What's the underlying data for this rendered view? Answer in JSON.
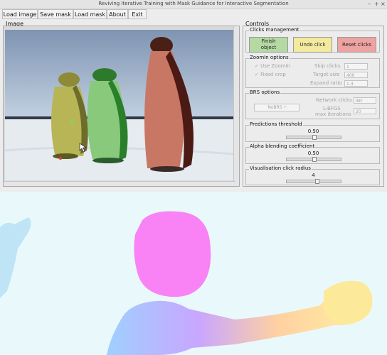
{
  "window": {
    "title": "Reviving Iterative Training with Mask Guidance for Interactive Segmentation",
    "controls": [
      "–",
      "+",
      "×"
    ]
  },
  "menu": [
    "Load image",
    "Save mask",
    "Load mask",
    "About",
    "Exit"
  ],
  "image_panel": {
    "label": "Image"
  },
  "controls": {
    "label": "Controls",
    "clicks": {
      "title": "Clicks management",
      "finish_label": "Finish\nobject",
      "undo_label": "Undo click",
      "reset_label": "Reset clicks",
      "colors": {
        "finish": "#b5d9a3",
        "undo": "#f3eaa0",
        "reset": "#eea3a3"
      }
    },
    "zoomin": {
      "title": "ZoomIn options",
      "use_zoomin": "Use ZoomIn",
      "fixed_crop": "Fixed crop",
      "skip_clicks_label": "Skip clicks",
      "skip_clicks": "1",
      "target_size_label": "Target size",
      "target_size": "400",
      "expand_ratio_label": "Expand ratio",
      "expand_ratio": "1.4"
    },
    "brs": {
      "title": "BRS options",
      "mode": "NoBRS",
      "network_clicks_label": "Network clicks",
      "network_clicks": "INF",
      "lbfgs_label_1": "L-BFGS",
      "lbfgs_label_2": "max iterations",
      "lbfgs_value": "20"
    },
    "prediction": {
      "title": "Predictions threshold",
      "value": "0.50",
      "fraction": 0.5
    },
    "alpha": {
      "title": "Alpha blending coefficient",
      "value": "0.50",
      "fraction": 0.5
    },
    "radius": {
      "title": "Visualisation click radius",
      "value": "4",
      "fraction": 0.55
    }
  }
}
